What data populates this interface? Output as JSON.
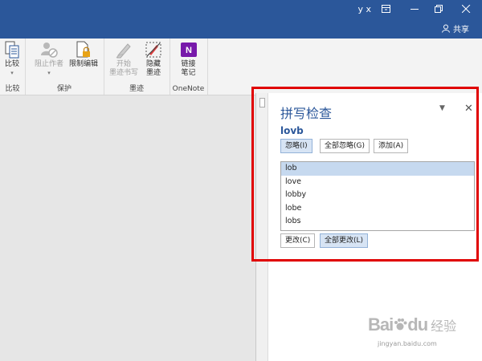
{
  "titlebar": {
    "user": "y x",
    "share_label": "共享",
    "colors": {
      "bg": "#2b579a",
      "text": "#ffffff"
    }
  },
  "ribbon": {
    "compare": {
      "button_label": "比较",
      "group_label": "比较"
    },
    "protect": {
      "block_authors": "阻止作者",
      "restrict_editing": "限制编辑",
      "group_label": "保护"
    },
    "ink": {
      "start_inking_line1": "开始",
      "start_inking_line2": "墨迹书写",
      "hide_ink_line1": "隐藏",
      "hide_ink_line2": "墨迹",
      "group_label": "墨迹"
    },
    "onenote": {
      "link_notes_line1": "链接",
      "link_notes_line2": "笔记",
      "group_label": "OneNote"
    }
  },
  "spelling_pane": {
    "title": "拼写检查",
    "misspelled_word": "lovb",
    "ignore_label": "忽略(I)",
    "ignore_all_label": "全部忽略(G)",
    "add_label": "添加(A)",
    "suggestions": [
      "lob",
      "love",
      "lobby",
      "lobe",
      "lobs"
    ],
    "selected_suggestion_index": 0,
    "change_label": "更改(C)",
    "change_all_label": "全部更改(L)"
  },
  "watermark": {
    "brand": "Bai",
    "brand_suffix": "du",
    "cn": "经验",
    "url": "jingyan.baidu.com"
  }
}
